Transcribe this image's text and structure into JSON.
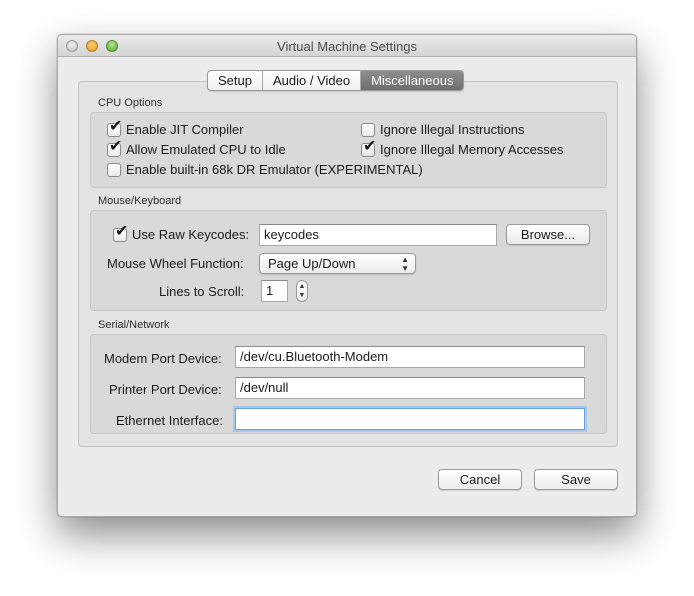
{
  "window": {
    "title": "Virtual Machine Settings"
  },
  "tabs": [
    "Setup",
    "Audio / Video",
    "Miscellaneous"
  ],
  "active_tab": "Miscellaneous",
  "cpu": {
    "section_label": "CPU Options",
    "enable_jit": {
      "label": "Enable JIT Compiler",
      "checked": true
    },
    "allow_idle": {
      "label": "Allow Emulated CPU to Idle",
      "checked": true
    },
    "dr_emulator": {
      "label": "Enable built-in 68k DR Emulator (EXPERIMENTAL)",
      "checked": false
    },
    "ignore_illegal_instr": {
      "label": "Ignore Illegal Instructions",
      "checked": false
    },
    "ignore_illegal_mem": {
      "label": "Ignore Illegal Memory Accesses",
      "checked": true
    }
  },
  "mouse": {
    "section_label": "Mouse/Keyboard",
    "raw_keycodes": {
      "label": "Use Raw Keycodes:",
      "checked": true,
      "value": "keycodes"
    },
    "browse_label": "Browse...",
    "wheel_label": "Mouse Wheel Function:",
    "wheel_value": "Page Up/Down",
    "lines_label": "Lines to Scroll:",
    "lines_value": "1"
  },
  "serial": {
    "section_label": "Serial/Network",
    "modem_label": "Modem Port Device:",
    "modem_value": "/dev/cu.Bluetooth-Modem",
    "printer_label": "Printer Port Device:",
    "printer_value": "/dev/null",
    "ethernet_label": "Ethernet Interface:",
    "ethernet_value": ""
  },
  "buttons": {
    "cancel": "Cancel",
    "save": "Save"
  },
  "icons": {
    "checkmark": "✔",
    "popup_arrows": "▲▼",
    "stepper_arrows": "▲▼"
  }
}
